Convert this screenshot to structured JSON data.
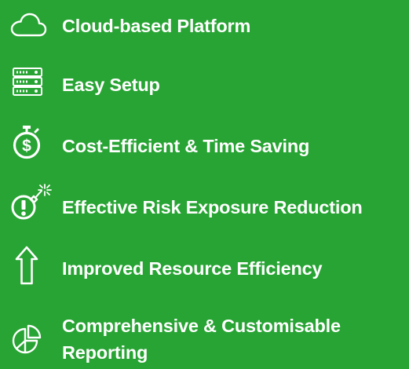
{
  "features": [
    {
      "icon": "cloud-icon",
      "label": "Cloud-based Platform"
    },
    {
      "icon": "server-rack-icon",
      "label": "Easy Setup"
    },
    {
      "icon": "stopwatch-dollar-icon",
      "label": "Cost-Efficient & Time Saving"
    },
    {
      "icon": "bomb-icon",
      "label": "Effective Risk Exposure Reduction"
    },
    {
      "icon": "arrow-up-icon",
      "label": "Improved Resource Efficiency"
    },
    {
      "icon": "pie-chart-icon",
      "label": "Comprehensive & Customisable Reporting"
    }
  ],
  "colors": {
    "background": "#27a433",
    "foreground": "#ffffff"
  }
}
